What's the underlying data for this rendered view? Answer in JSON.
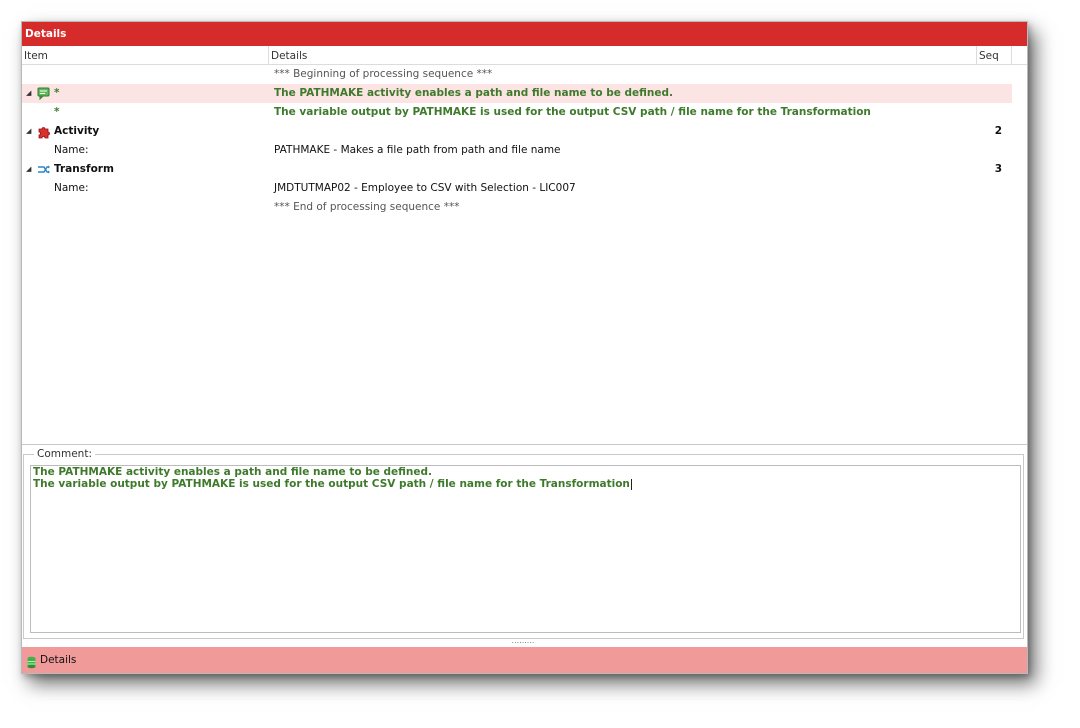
{
  "window": {
    "title": "Details"
  },
  "grid": {
    "columns": {
      "item": "Item",
      "details": "Details",
      "seq": "Seq"
    },
    "rows": [
      {
        "expander": "",
        "item": "",
        "details": "*** Beginning of processing sequence ***",
        "seq": ""
      },
      {
        "expander": "◢",
        "item": "*",
        "details": "The PATHMAKE activity enables a path and file name to be defined.",
        "seq": ""
      },
      {
        "expander": "",
        "item": "*",
        "details": "The variable output by PATHMAKE is used for the output CSV path / file name for the Transformation",
        "seq": ""
      },
      {
        "expander": "◢",
        "item": "Activity",
        "details": "",
        "seq": "2"
      },
      {
        "expander": "",
        "item": "Name:",
        "details": "PATHMAKE - Makes a file path from path and file name",
        "seq": ""
      },
      {
        "expander": "◢",
        "item": "Transform",
        "details": "",
        "seq": "3"
      },
      {
        "expander": "",
        "item": "Name:",
        "details": "JMDTUTMAP02 - Employee to CSV with Selection - LIC007",
        "seq": ""
      },
      {
        "expander": "",
        "item": "",
        "details": "*** End of processing sequence ***",
        "seq": ""
      }
    ]
  },
  "comment": {
    "legend": "Comment:",
    "lines": [
      "The PATHMAKE activity enables a path and file name to be defined.",
      "The variable output by PATHMAKE is used for the output CSV path / file name for the Transformation"
    ]
  },
  "splitter": {
    "grip": "........."
  },
  "status_bar": {
    "label": "Details"
  },
  "icons": {
    "comment": "comment-icon",
    "activity": "puzzle-icon",
    "transform": "transform-icon",
    "status": "database-icon"
  },
  "colors": {
    "title_bar": "#d52b2b",
    "status_bar": "#f09a9a",
    "selected_row": "#fde4e4",
    "comment_text": "#3e7a2b"
  }
}
